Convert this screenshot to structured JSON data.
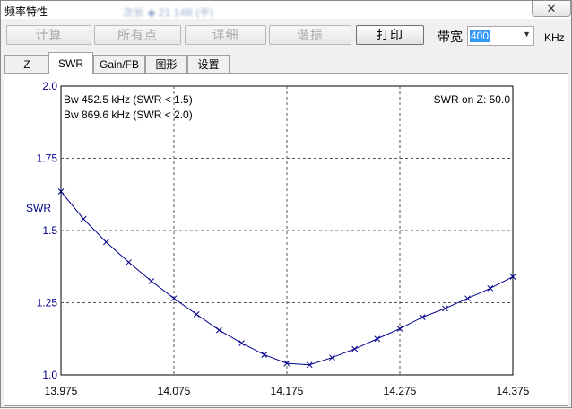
{
  "window": {
    "title": "频率特性",
    "blurred_title": "次长 ◆ 21 14B (半)",
    "close_icon": "close-icon-x"
  },
  "toolbar": {
    "calc_label": "计算",
    "all_points_label": "所有点",
    "detail_label": "详细",
    "harmonic_label": "谐振",
    "print_label": "打印",
    "bandwidth_label": "带宽",
    "bandwidth_value": "400",
    "bandwidth_unit": "KHz"
  },
  "tabs": [
    {
      "label": "Z"
    },
    {
      "label": "SWR"
    },
    {
      "label": "Gain/FB"
    },
    {
      "label": "图形"
    },
    {
      "label": "设置"
    }
  ],
  "selected_tab": "SWR",
  "chart_data": {
    "type": "line",
    "ylabel": "SWR",
    "xlabel": "",
    "xlim": [
      13.975,
      14.375
    ],
    "ylim": [
      1.0,
      2.0
    ],
    "x_ticks": [
      "13.975",
      "14.075",
      "14.175",
      "14.275",
      "14.375"
    ],
    "y_ticks": [
      "2.0",
      "1.75",
      "1.5",
      "1.25",
      "1.0"
    ],
    "grid": true,
    "annotations": {
      "bw1": "Bw 452.5 kHz (SWR < 1.5)",
      "bw2": "Bw 869.6 kHz (SWR < 2.0)",
      "z": "SWR on Z: 50.0"
    },
    "line_color": "#00008b",
    "series": [
      {
        "x": [
          13.975,
          13.995,
          14.015,
          14.035,
          14.055,
          14.075,
          14.095,
          14.115,
          14.135,
          14.155,
          14.175,
          14.195,
          14.215,
          14.235,
          14.255,
          14.275,
          14.295,
          14.315,
          14.335,
          14.355,
          14.375
        ],
        "values": [
          1.635,
          1.54,
          1.46,
          1.39,
          1.325,
          1.265,
          1.21,
          1.155,
          1.11,
          1.07,
          1.04,
          1.035,
          1.06,
          1.09,
          1.125,
          1.16,
          1.2,
          1.23,
          1.265,
          1.3,
          1.34
        ]
      }
    ]
  }
}
